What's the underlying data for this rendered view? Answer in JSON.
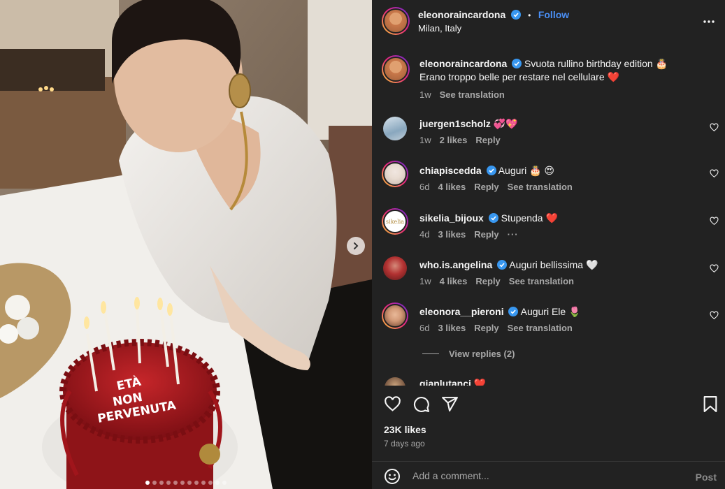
{
  "post": {
    "author": "eleonoraincardona",
    "follow_label": "Follow",
    "separator": "•",
    "location": "Milan, Italy",
    "carousel_active_index": 0,
    "cake_text": [
      "ETÀ",
      "NON",
      "PERVENUTA"
    ]
  },
  "caption": {
    "user": "eleonoraincardona",
    "line1": "Svuota rullino birthday edition 🎂",
    "line2": "Erano troppo belle per restare nel cellulare ❤️",
    "time": "1w",
    "see_translation": "See translation"
  },
  "comments": [
    {
      "user": "juergen1scholz",
      "verified": false,
      "text": "💞💖",
      "time": "1w",
      "likes": "2 likes",
      "reply": "Reply",
      "translation": ""
    },
    {
      "user": "chiapiscedda",
      "verified": true,
      "text": "Auguri 🎂 😍",
      "time": "6d",
      "likes": "4 likes",
      "reply": "Reply",
      "translation": "See translation"
    },
    {
      "user": "sikelia_bijoux",
      "verified": true,
      "text": "Stupenda ❤️",
      "time": "4d",
      "likes": "3 likes",
      "reply": "Reply",
      "translation": "",
      "more": "···",
      "avatar_text": "sikelia"
    },
    {
      "user": "who.is.angelina",
      "verified": true,
      "text": "Auguri bellissima 🤍",
      "time": "1w",
      "likes": "4 likes",
      "reply": "Reply",
      "translation": "See translation"
    },
    {
      "user": "eleonora__pieroni",
      "verified": true,
      "text": "Auguri Ele 🌷",
      "time": "6d",
      "likes": "3 likes",
      "reply": "Reply",
      "translation": "See translation"
    }
  ],
  "view_replies": "View replies (2)",
  "partial_comment": {
    "user": "gianlutanci",
    "text": "❤️"
  },
  "likes_count": "23K likes",
  "posted_ago": "7 days ago",
  "add_comment": {
    "placeholder": "Add a comment...",
    "post_label": "Post"
  },
  "colors": {
    "background": "#222222",
    "link": "#4a8ff5",
    "muted": "#a8a8a8",
    "verified": "#3897f0"
  },
  "icons": [
    "more-icon",
    "heart-icon",
    "comment-icon",
    "share-icon",
    "bookmark-icon",
    "emoji-icon",
    "chevron-right-icon",
    "verified-icon"
  ]
}
